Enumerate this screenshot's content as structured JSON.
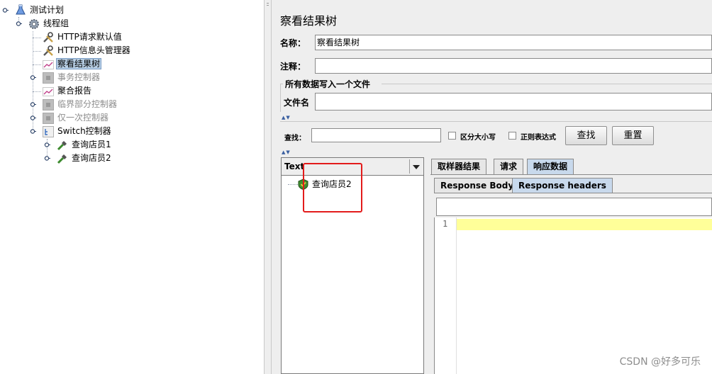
{
  "tree": {
    "items": [
      {
        "label": "测试计划",
        "icon": "flask-icon"
      },
      {
        "label": "线程组",
        "icon": "gear-icon"
      },
      {
        "label": "HTTP请求默认值",
        "icon": "wrench-icon"
      },
      {
        "label": "HTTP信息头管理器",
        "icon": "wrench-icon"
      },
      {
        "label": "察看结果树",
        "icon": "chart-icon"
      },
      {
        "label": "事务控制器",
        "icon": "controller-icon"
      },
      {
        "label": "聚合报告",
        "icon": "chart-icon"
      },
      {
        "label": "临界部分控制器",
        "icon": "controller-icon"
      },
      {
        "label": "仅一次控制器",
        "icon": "controller-icon"
      },
      {
        "label": "Switch控制器",
        "icon": "switch-icon"
      },
      {
        "label": "查询店员1",
        "icon": "pipette-icon"
      },
      {
        "label": "查询店员2",
        "icon": "pipette-icon"
      }
    ]
  },
  "panel": {
    "title": "察看结果树",
    "name_label": "名称：",
    "name_value": "察看结果树",
    "comment_label": "注释：",
    "comment_value": "",
    "file_group_title": "所有数据写入一个文件",
    "filename_label": "文件名",
    "filename_value": ""
  },
  "search": {
    "label": "查找：",
    "value": "",
    "case_label": "区分大小写",
    "regex_label": "正则表达式",
    "find_button": "查找",
    "reset_button": "重置"
  },
  "results": {
    "renderer": "Text",
    "sample_label": "查询店员2"
  },
  "tabs": {
    "main": [
      "取样器结果",
      "请求",
      "响应数据"
    ],
    "sub": [
      "Response Body",
      "Response headers"
    ]
  },
  "editor": {
    "line_number": "1"
  },
  "watermark": "CSDN @好多可乐",
  "colors": {
    "highlight_line": "#ffff99",
    "red_annotation": "#e31b1b",
    "selection": "#b8cfe5"
  }
}
